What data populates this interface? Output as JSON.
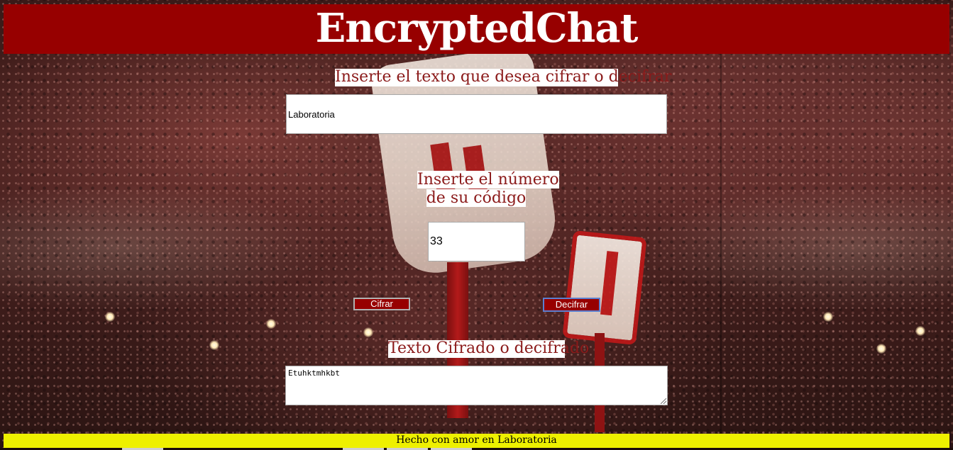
{
  "app": {
    "title": "EncryptedChat"
  },
  "form": {
    "text_label": "Inserte el texto que desea cifrar o decifrar",
    "text_value": "Laboratoria",
    "number_label_line1": "Inserte el número",
    "number_label_line2": "de su código",
    "number_value": "33",
    "cifrar_label": "Cifrar",
    "decifrar_label": "Decifrar",
    "output_label": "Texto Cifrado o decifrado",
    "output_value": "Etuhktmhkbt"
  },
  "footer": {
    "text": "Hecho con amor en Laboratoria"
  },
  "colors": {
    "header_bg": "#970000",
    "button_bg": "#970000",
    "footer_bg": "#eef000",
    "label_text": "#8b1a1a"
  }
}
